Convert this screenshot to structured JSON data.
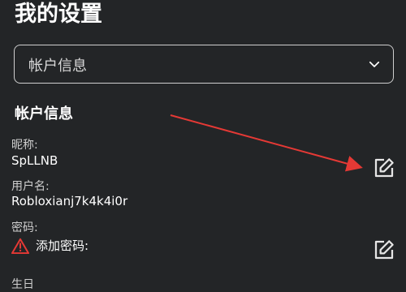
{
  "page": {
    "title": "我的设置"
  },
  "section_select": {
    "selected": "帐户信息"
  },
  "account": {
    "section_title": "帐户信息",
    "nickname_label": "昵称:",
    "nickname_value": "SpLLNB",
    "username_label": "用户名:",
    "username_value": "Robloxianj7k4k4i0r",
    "password_label": "密码:",
    "add_password_label": "添加密码:",
    "birthday_label_partial": "生日"
  },
  "colors": {
    "background": "#232527",
    "arrow": "#e53935",
    "warning": "#e53935"
  },
  "icons": {
    "dropdown": "chevron-down-icon",
    "edit": "edit-icon",
    "warning": "warning-icon"
  }
}
